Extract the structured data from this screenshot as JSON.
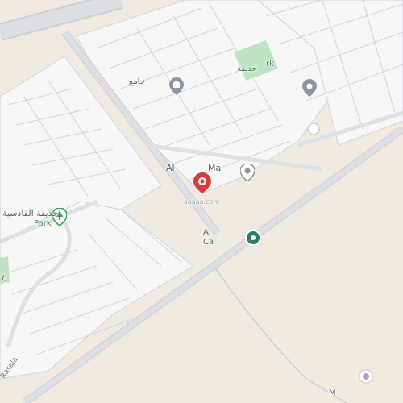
{
  "colors": {
    "background": "#efe9df",
    "block_fill": "#f7f7f7",
    "road": "#dcdfe3",
    "road_edge": "#c9cdd2",
    "park": "#bfe3c2",
    "park_pin": "#2e9b4f",
    "red_pin": "#d93b3b",
    "gray_pin": "#8d959e",
    "teal_pin": "#2e7d6a"
  },
  "labels": {
    "park_left_ar": "حديقة القادسية",
    "park_left_en": "Park",
    "park_top_ar": "حديقة",
    "park_top_en": "rk",
    "mosque_top_ar": "جامع",
    "place_center_al": "Al",
    "place_center_ma": "Ma",
    "red_pin_caption": "aaaaa.com",
    "teal_pin_al": "Al",
    "teal_pin_ca": "Ca",
    "road_bottom_left": "Rasala",
    "bottom_right_m": "M",
    "left_edge_ar": "ح"
  },
  "icons": {
    "park_pin": "park-pin-icon",
    "mosque_pin": "mosque-pin-icon",
    "red_pin": "location-pin-icon",
    "teal_pin": "place-pin-icon",
    "gray_pin": "place-pin-icon"
  }
}
